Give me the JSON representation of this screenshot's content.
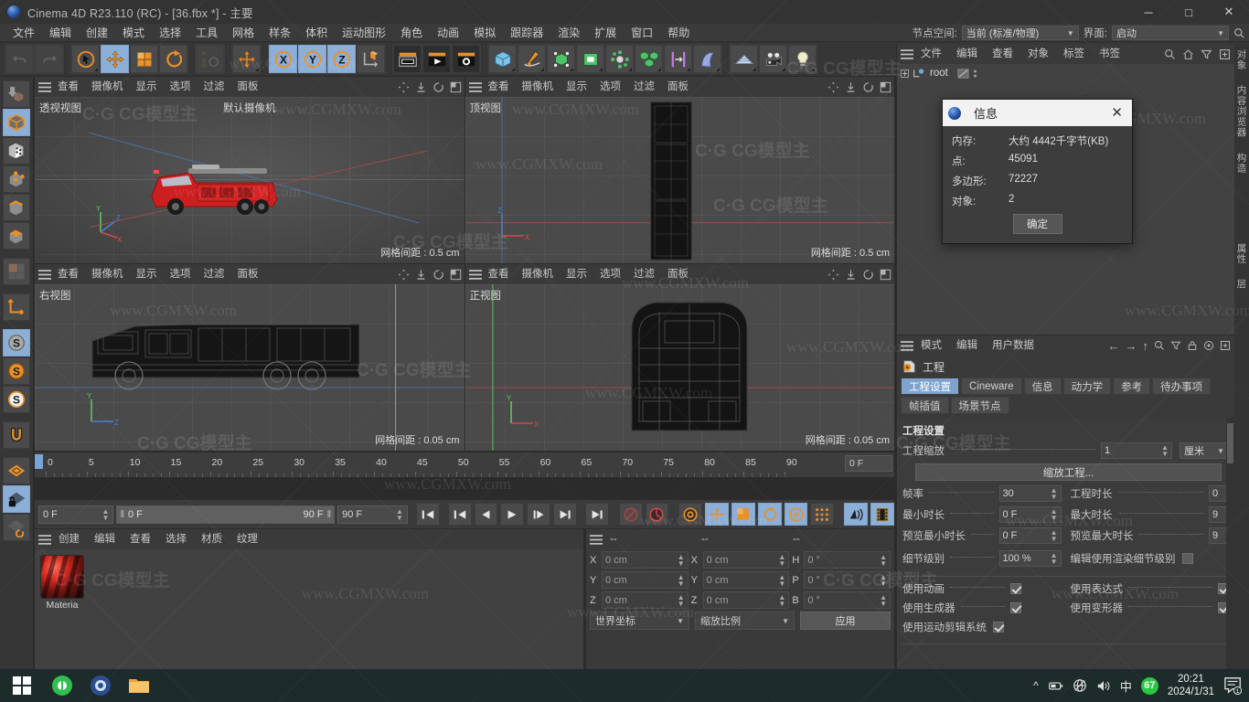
{
  "window": {
    "title": "Cinema 4D R23.110 (RC) - [36.fbx *] - 主要",
    "minimize": "─",
    "maximize": "□",
    "close": "✕"
  },
  "menubar": {
    "items": [
      "文件",
      "编辑",
      "创建",
      "模式",
      "选择",
      "工具",
      "网格",
      "样条",
      "体积",
      "运动图形",
      "角色",
      "动画",
      "模拟",
      "跟踪器",
      "渲染",
      "扩展",
      "窗口",
      "帮助"
    ],
    "node_space_label": "节点空间:",
    "node_space_value": "当前 (标准/物理)",
    "layout_label": "界面:",
    "layout_value": "启动"
  },
  "viewports": [
    {
      "menu": [
        "查看",
        "摄像机",
        "显示",
        "选项",
        "过滤",
        "面板"
      ],
      "label": "透视视图",
      "camera": "默认摄像机",
      "grid_info": "网格间距 : 0.5 cm"
    },
    {
      "menu": [
        "查看",
        "摄像机",
        "显示",
        "选项",
        "过滤",
        "面板"
      ],
      "label": "顶视图",
      "camera": "",
      "grid_info": "网格间距 : 0.5 cm"
    },
    {
      "menu": [
        "查看",
        "摄像机",
        "显示",
        "选项",
        "过滤",
        "面板"
      ],
      "label": "右视图",
      "camera": "",
      "grid_info": "网格间距 : 0.05 cm"
    },
    {
      "menu": [
        "查看",
        "摄像机",
        "显示",
        "选项",
        "过滤",
        "面板"
      ],
      "label": "正视图",
      "camera": "",
      "grid_info": "网格间距 : 0.05 cm"
    }
  ],
  "timeline": {
    "ticks": [
      0,
      5,
      10,
      15,
      20,
      25,
      30,
      35,
      40,
      45,
      50,
      55,
      60,
      65,
      70,
      75,
      80,
      85,
      90
    ],
    "end_value": "0 F"
  },
  "transport": {
    "current_frame": "0 F",
    "range_start": "0 F",
    "range_end": "90 F",
    "max_frame": "90 F"
  },
  "material_manager": {
    "menu": [
      "创建",
      "编辑",
      "查看",
      "选择",
      "材质",
      "纹理"
    ],
    "materials": [
      {
        "name": "Materia"
      }
    ]
  },
  "coordinates": {
    "header_dashes": [
      "--",
      "--",
      "--"
    ],
    "rows": [
      {
        "label": "X",
        "pos": "0 cm",
        "size": "0 cm",
        "rot_label": "H",
        "rot": "0 °"
      },
      {
        "label": "Y",
        "pos": "0 cm",
        "size": "0 cm",
        "rot_label": "P",
        "rot": "0 °"
      },
      {
        "label": "Z",
        "pos": "0 cm",
        "size": "0 cm",
        "rot_label": "B",
        "rot": "0 °"
      }
    ],
    "coord_system": "世界坐标",
    "scale_mode": "缩放比例",
    "apply": "应用"
  },
  "object_manager": {
    "menu": [
      "文件",
      "编辑",
      "查看",
      "对象",
      "标签",
      "书签"
    ],
    "root_item": "root",
    "side_tabs": [
      "对象",
      "内容浏览器",
      "构造"
    ]
  },
  "attribute_manager": {
    "menu": [
      "模式",
      "编辑",
      "用户数据"
    ],
    "object_name": "工程",
    "tabs": [
      "工程设置",
      "Cineware",
      "信息",
      "动力学",
      "参考",
      "待办事项",
      "帧插值",
      "场景节点"
    ],
    "active_tab": "工程设置",
    "section_title": "工程设置",
    "fields": {
      "project_scale_label": "工程缩放",
      "project_scale_value": "1",
      "project_scale_unit": "厘米",
      "scale_project_button": "缩放工程...",
      "fps_label": "帧率",
      "fps_value": "30",
      "project_length_label": "工程时长",
      "project_length_value": "0",
      "min_length_label": "最小时长",
      "min_length_value": "0 F",
      "max_length_label": "最大时长",
      "max_length_value": "9",
      "preview_min_label": "预览最小时长",
      "preview_min_value": "0 F",
      "preview_max_label": "预览最大时长",
      "preview_max_value": "9",
      "lod_label": "细节级别",
      "lod_value": "100 %",
      "render_lod_label": "编辑使用渲染细节级别",
      "use_animation_label": "使用动画",
      "use_animation": true,
      "use_expression_label": "使用表达式",
      "use_expression": true,
      "use_generator_label": "使用生成器",
      "use_generator": true,
      "use_deformer_label": "使用变形器",
      "use_deformer": true,
      "use_motion_clip_label": "使用运动剪辑系统",
      "use_motion_clip": true
    },
    "side_tabs": [
      "属性",
      "层"
    ]
  },
  "dialog": {
    "title": "信息",
    "close": "✕",
    "rows": [
      {
        "key": "内存:",
        "value": "大约 4442千字节(KB)"
      },
      {
        "key": "点:",
        "value": "45091"
      },
      {
        "key": "多边形:",
        "value": "72227"
      },
      {
        "key": "对象:",
        "value": "2"
      }
    ],
    "ok": "确定"
  },
  "taskbar": {
    "time": "20:21",
    "date": "2024/1/31",
    "ime": "中",
    "badge": "67",
    "notification": "1"
  },
  "watermark": {
    "text": "www.CGMXW.com",
    "logo": "CG模型主"
  },
  "colors": {
    "accent_blue": "#8cafd8",
    "orange": "#e8902a",
    "axis_x": "#d14b4b",
    "axis_y": "#5ec45e",
    "axis_z": "#4b7fd1"
  }
}
